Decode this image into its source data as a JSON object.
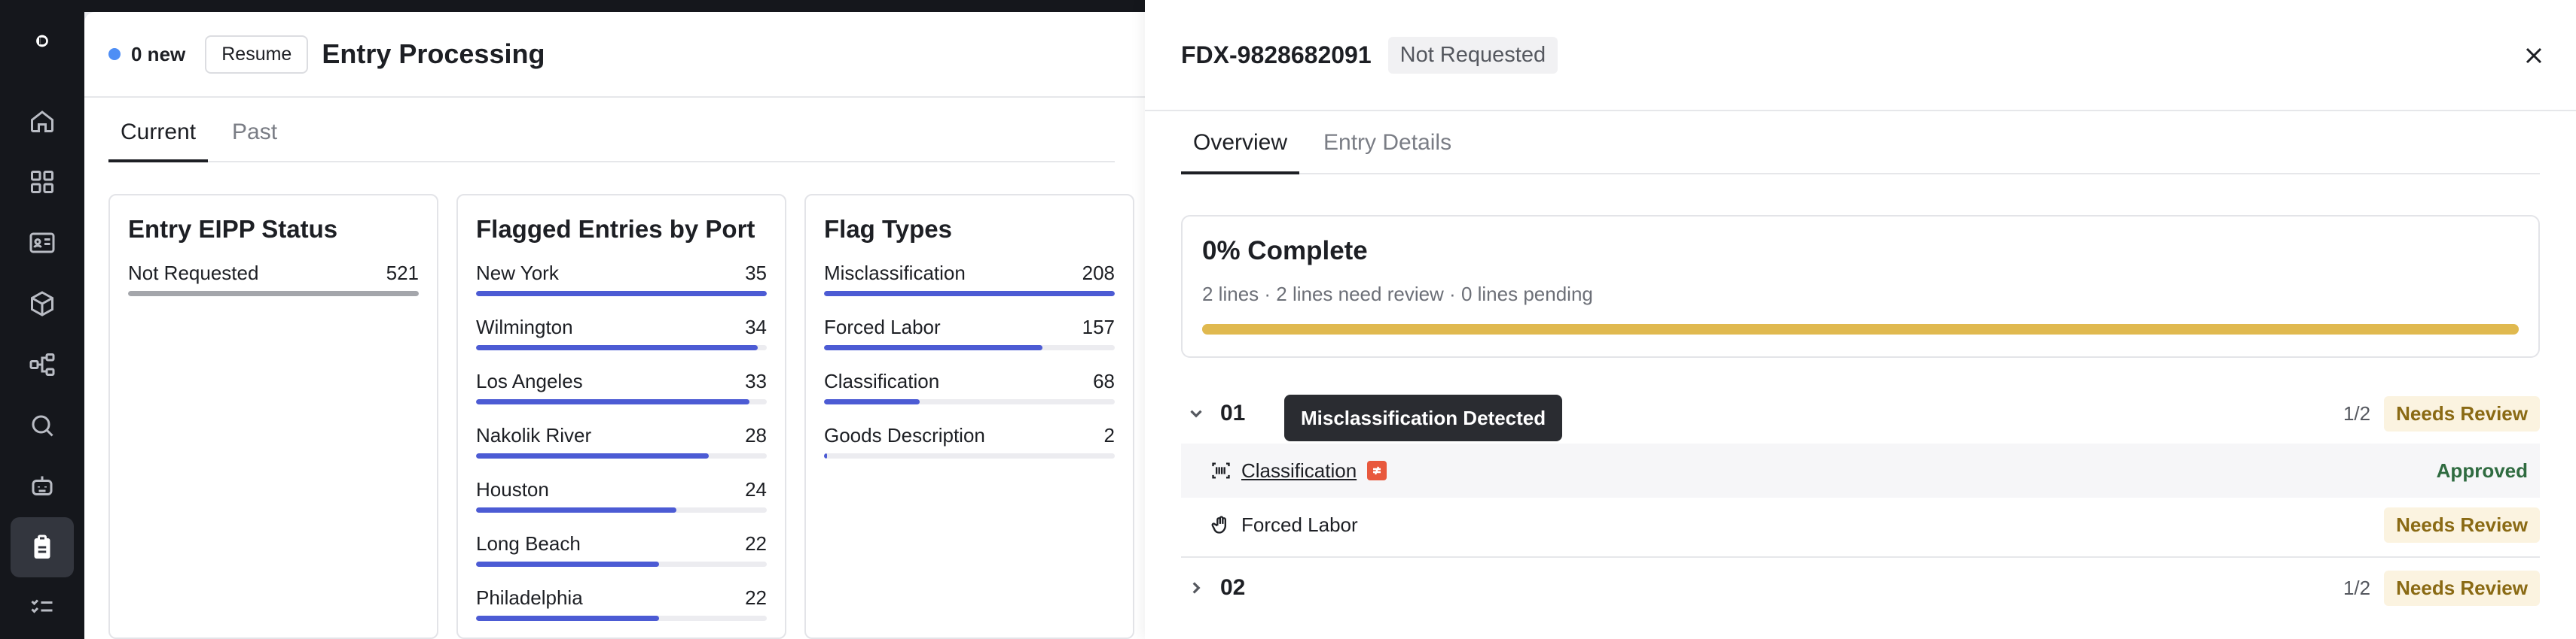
{
  "header": {
    "new_count": "0 new",
    "resume_label": "Resume",
    "title": "Entry Processing"
  },
  "tabs": [
    {
      "label": "Current"
    },
    {
      "label": "Past"
    }
  ],
  "cards": [
    {
      "title": "Entry EIPP Status",
      "rows": [
        {
          "label": "Not Requested",
          "value": "521",
          "fill": 1.0
        }
      ]
    },
    {
      "title": "Flagged Entries by Port",
      "rows": [
        {
          "label": "New York",
          "value": "35",
          "fill": 1.0
        },
        {
          "label": "Wilmington",
          "value": "34",
          "fill": 0.97
        },
        {
          "label": "Los Angeles",
          "value": "33",
          "fill": 0.94
        },
        {
          "label": "Nakolik River",
          "value": "28",
          "fill": 0.8
        },
        {
          "label": "Houston",
          "value": "24",
          "fill": 0.69
        },
        {
          "label": "Long Beach",
          "value": "22",
          "fill": 0.63
        },
        {
          "label": "Philadelphia",
          "value": "22",
          "fill": 0.63
        }
      ]
    },
    {
      "title": "Flag Types",
      "rows": [
        {
          "label": "Misclassification",
          "value": "208",
          "fill": 1.0
        },
        {
          "label": "Forced Labor",
          "value": "157",
          "fill": 0.75
        },
        {
          "label": "Classification",
          "value": "68",
          "fill": 0.33
        },
        {
          "label": "Goods Description",
          "value": "2",
          "fill": 0.01
        }
      ]
    }
  ],
  "drawer": {
    "entry_id": "FDX-9828682091",
    "status": "Not Requested",
    "tabs": [
      {
        "label": "Overview"
      },
      {
        "label": "Entry Details"
      }
    ],
    "progress": {
      "title": "0% Complete",
      "summary": "2 lines · 2 lines need review · 0 lines pending",
      "complete_fraction": 0.0
    },
    "lines": [
      {
        "number": "01",
        "count": "1/2",
        "status": "Needs Review",
        "tooltip": "Misclassification Detected",
        "items": [
          {
            "label": "Classification",
            "status": "Approved"
          },
          {
            "label": "Forced Labor",
            "status": "Needs Review"
          }
        ]
      },
      {
        "number": "02",
        "count": "1/2",
        "status": "Needs Review"
      }
    ]
  },
  "colors": {
    "accent": "#4c5bd4",
    "progress_track": "#e0b94f",
    "review_badge": "#fbf3e0",
    "sidebar": "#15171c"
  },
  "icons": {
    "sidebar": [
      "home-icon",
      "grid-icon",
      "id-card-icon",
      "box-icon",
      "workflow-icon",
      "search-icon",
      "robot-icon",
      "clipboard-icon",
      "checklist-icon"
    ]
  }
}
